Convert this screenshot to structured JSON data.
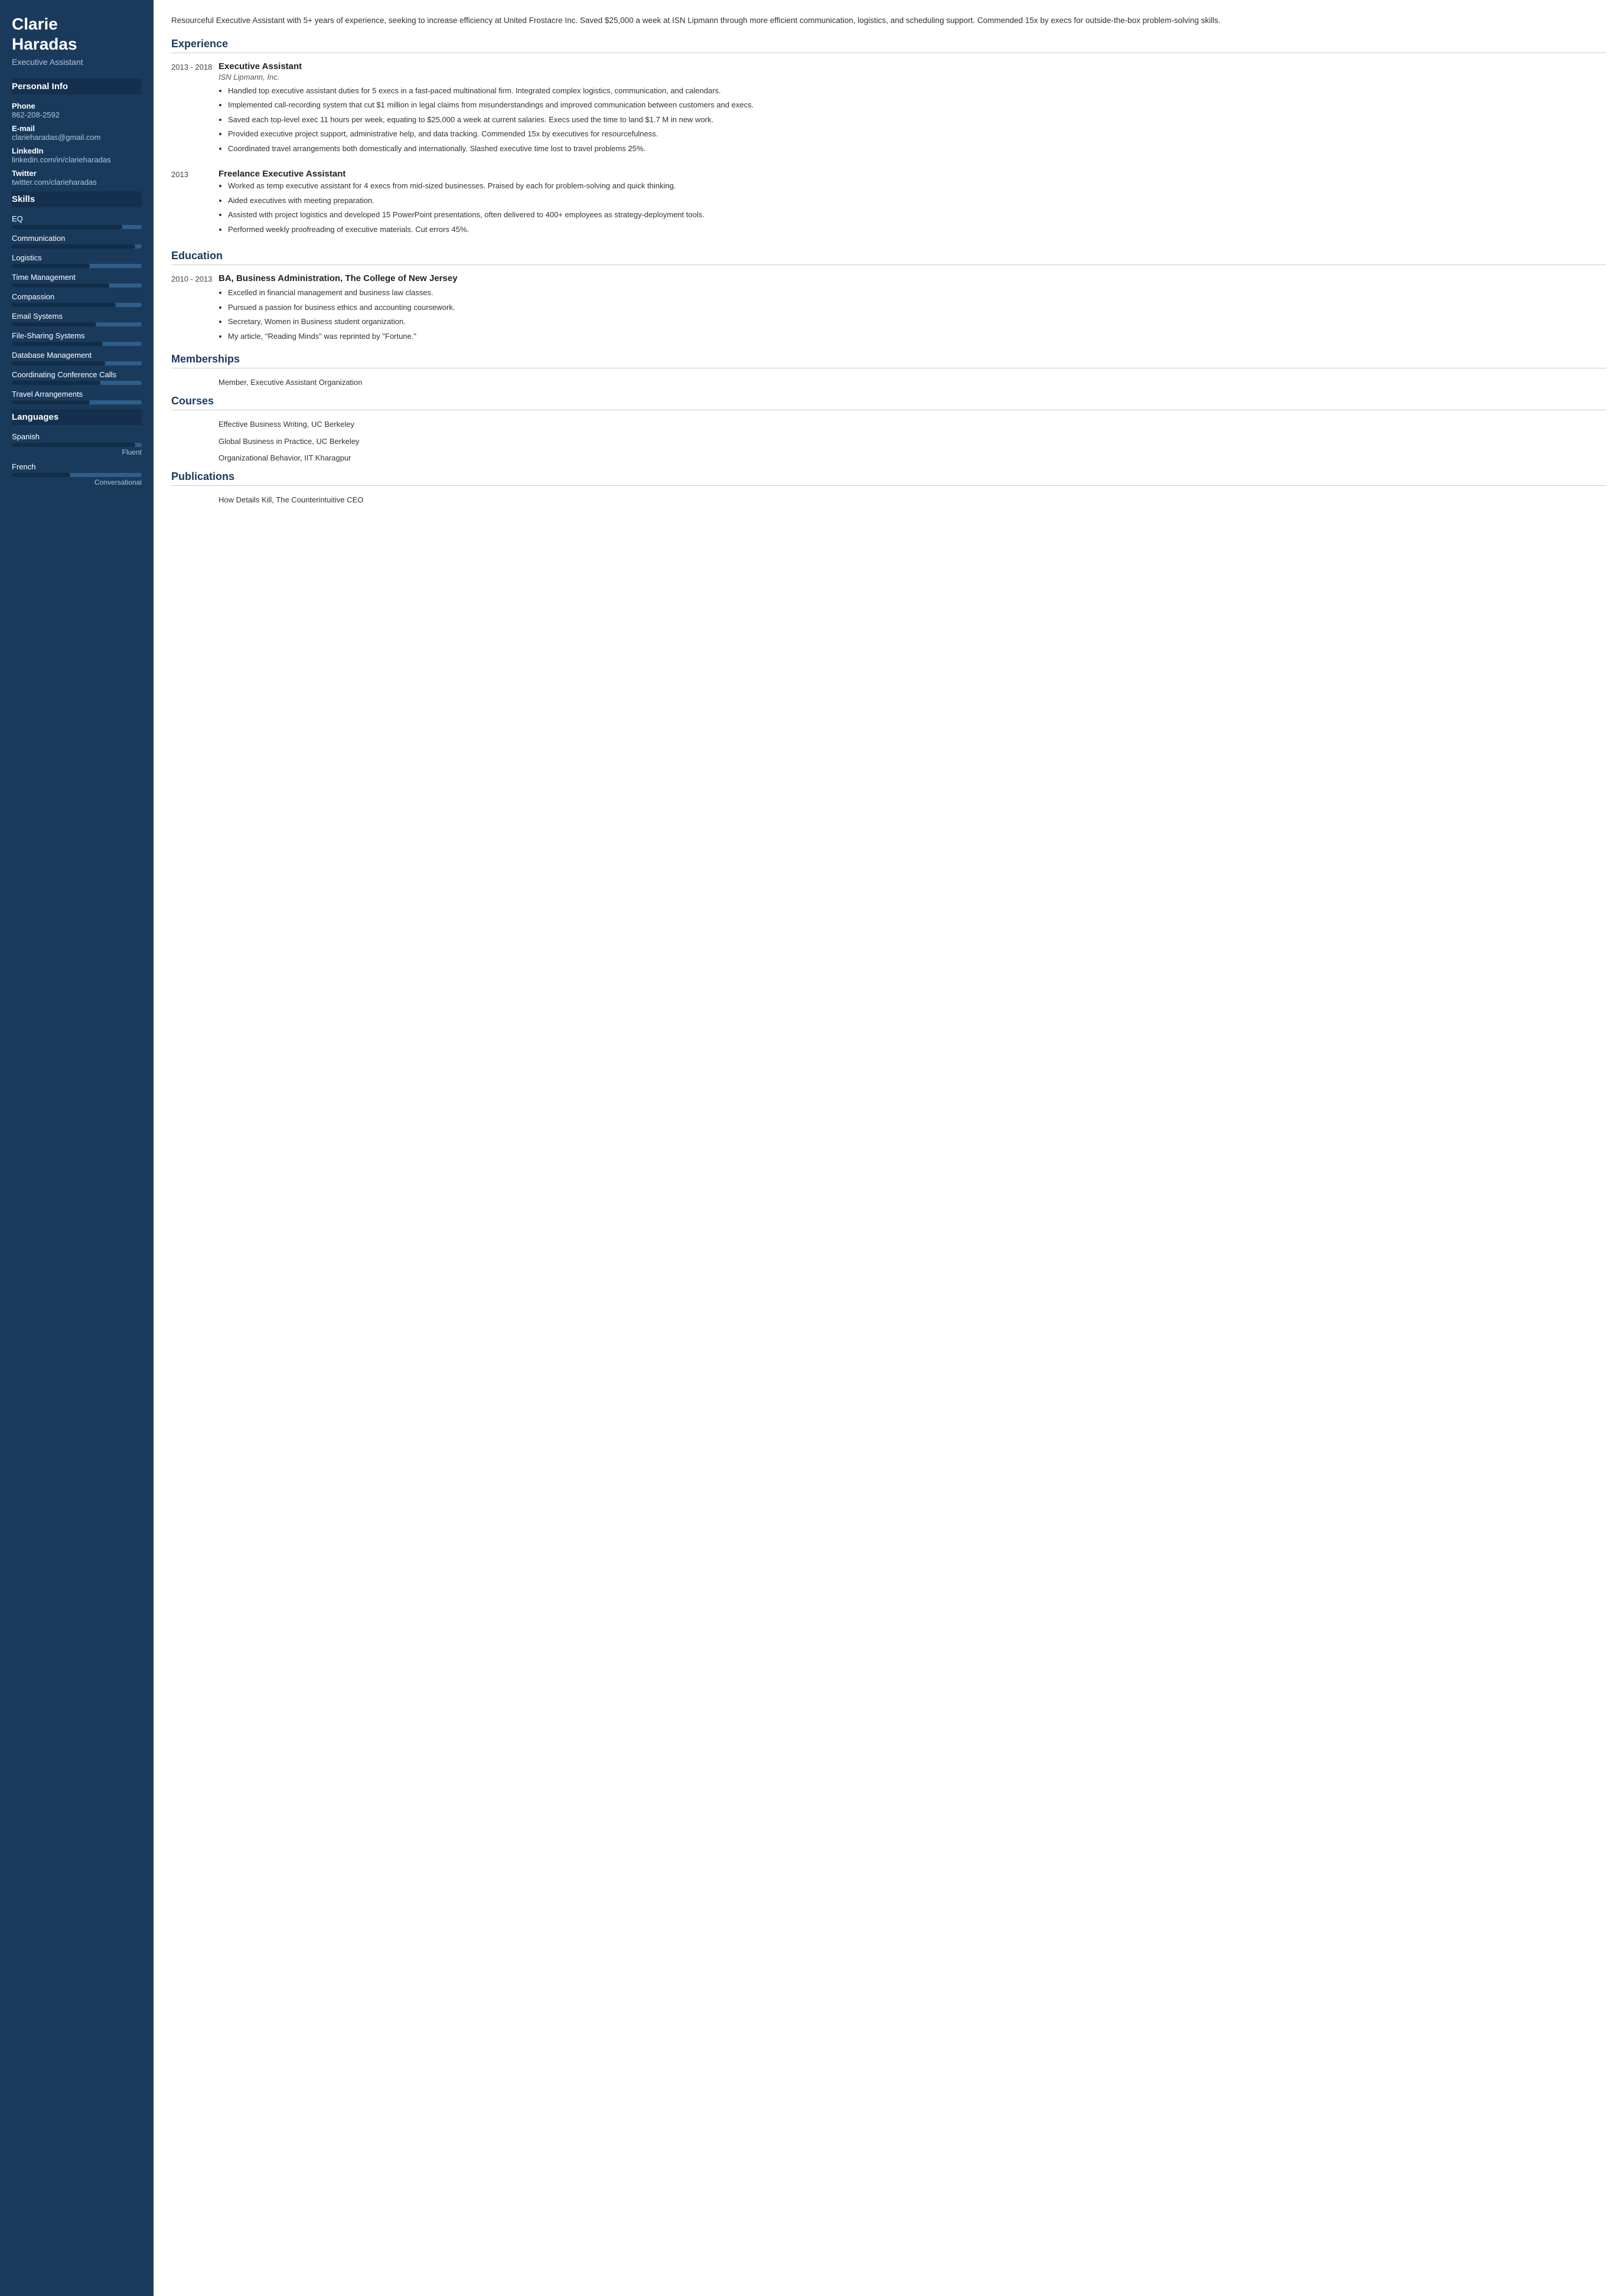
{
  "sidebar": {
    "name_line1": "Clarie",
    "name_line2": "Haradas",
    "title": "Executive Assistant",
    "sections": {
      "personal_info": {
        "label": "Personal Info",
        "fields": [
          {
            "label": "Phone",
            "value": "862-208-2592"
          },
          {
            "label": "E-mail",
            "value": "clarieharadas@gmail.com"
          },
          {
            "label": "LinkedIn",
            "value": "linkedin.com/in/clarieharadas"
          },
          {
            "label": "Twitter",
            "value": "twitter.com/clarieharadas"
          }
        ]
      },
      "skills": {
        "label": "Skills",
        "items": [
          {
            "name": "EQ",
            "percent": 85
          },
          {
            "name": "Communication",
            "percent": 95
          },
          {
            "name": "Logistics",
            "percent": 60
          },
          {
            "name": "Time Management",
            "percent": 75
          },
          {
            "name": "Compassion",
            "percent": 80
          },
          {
            "name": "Email Systems",
            "percent": 65
          },
          {
            "name": "File-Sharing Systems",
            "percent": 70
          },
          {
            "name": "Database Management",
            "percent": 72
          },
          {
            "name": "Coordinating Conference Calls",
            "percent": 68
          },
          {
            "name": "Travel Arrangements",
            "percent": 60
          }
        ]
      },
      "languages": {
        "label": "Languages",
        "items": [
          {
            "name": "Spanish",
            "level": "Fluent",
            "percent": 95
          },
          {
            "name": "French",
            "level": "Conversational",
            "percent": 45
          }
        ]
      }
    }
  },
  "main": {
    "summary": "Resourceful Executive Assistant with 5+ years of experience, seeking to increase efficiency at United Frostacre Inc. Saved $25,000 a week at ISN Lipmann through more efficient communication, logistics, and scheduling support. Commended 15x by execs for outside-the-box problem-solving skills.",
    "experience": {
      "label": "Experience",
      "entries": [
        {
          "date": "2013 - 2018",
          "job_title": "Executive Assistant",
          "company": "ISN Lipmann, Inc.",
          "bullets": [
            "Handled top executive assistant duties for 5 execs in a fast-paced multinational firm. Integrated complex logistics, communication, and calendars.",
            "Implemented call-recording system that cut $1 million in legal claims from misunderstandings and improved communication between customers and execs.",
            "Saved each top-level exec 11 hours per week, equating to $25,000 a week at current salaries. Execs used the time to land $1.7 M in new work.",
            "Provided executive project support, administrative help, and data tracking. Commended 15x by executives for resourcefulness.",
            "Coordinated travel arrangements both domestically and internationally. Slashed executive time lost to travel problems 25%."
          ]
        },
        {
          "date": "2013",
          "job_title": "Freelance Executive Assistant",
          "company": "",
          "bullets": [
            "Worked as temp executive assistant for 4 execs from mid-sized businesses. Praised by each for problem-solving and quick thinking.",
            "Aided executives with meeting preparation.",
            "Assisted with project logistics and developed 15 PowerPoint presentations, often delivered to 400+ employees as strategy-deployment tools.",
            "Performed weekly proofreading of executive materials. Cut errors 45%."
          ]
        }
      ]
    },
    "education": {
      "label": "Education",
      "entries": [
        {
          "date": "2010 - 2013",
          "degree": "BA, Business Administration, The College of New Jersey",
          "bullets": [
            "Excelled in financial management and business law classes.",
            "Pursued a passion for business ethics and accounting coursework.",
            "Secretary, Women in Business student organization.",
            "My article, \"Reading Minds\" was reprinted by \"Fortune.\""
          ]
        }
      ]
    },
    "memberships": {
      "label": "Memberships",
      "entries": [
        {
          "text": "Member, Executive Assistant Organization"
        }
      ]
    },
    "courses": {
      "label": "Courses",
      "entries": [
        {
          "text": "Effective Business Writing, UC Berkeley"
        },
        {
          "text": "Global Business in Practice, UC Berkeley"
        },
        {
          "text": "Organizational Behavior, IIT Kharagpur"
        }
      ]
    },
    "publications": {
      "label": "Publications",
      "entries": [
        {
          "text": "How Details Kill, The Counterintuitive CEO"
        }
      ]
    }
  }
}
